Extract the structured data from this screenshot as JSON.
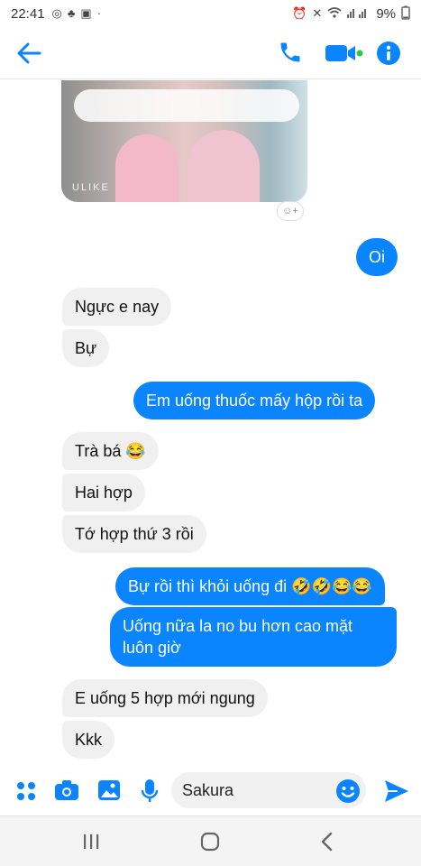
{
  "status": {
    "time": "22:41",
    "battery": "9%"
  },
  "header": {
    "back_icon": "arrow-left-icon",
    "call_icon": "phone-icon",
    "video_icon": "video-camera-icon",
    "info_icon": "info-icon"
  },
  "photo": {
    "watermark": "ULIKE"
  },
  "messages": [
    {
      "side": "out",
      "text": "Oi"
    },
    {
      "side": "in",
      "text": "Ngực e nay"
    },
    {
      "side": "in",
      "text": "Bự"
    },
    {
      "side": "out",
      "text": "Em uống thuốc mấy hộp rồi ta"
    },
    {
      "side": "in",
      "text": "Trà bá 😂"
    },
    {
      "side": "in",
      "text": "Hai hợp"
    },
    {
      "side": "in",
      "text": "Tớ hợp thứ 3 rồi"
    },
    {
      "side": "out",
      "text": "Bự rồi thì khỏi uống đi 🤣🤣😂😂"
    },
    {
      "side": "out",
      "text": "Uống nữa la no bu hơn cao mặt luôn giờ"
    },
    {
      "side": "in",
      "text": "E uống 5 hợp mới ngung"
    },
    {
      "side": "in",
      "text": "Kkk"
    }
  ],
  "composer": {
    "input_value": "Sakura",
    "icons": [
      "apps-icon",
      "camera-icon",
      "gallery-icon",
      "microphone-icon",
      "emoji-icon",
      "send-icon"
    ]
  },
  "colors": {
    "accent": "#0a84ff",
    "incoming_bubble": "#f1f0f0"
  }
}
